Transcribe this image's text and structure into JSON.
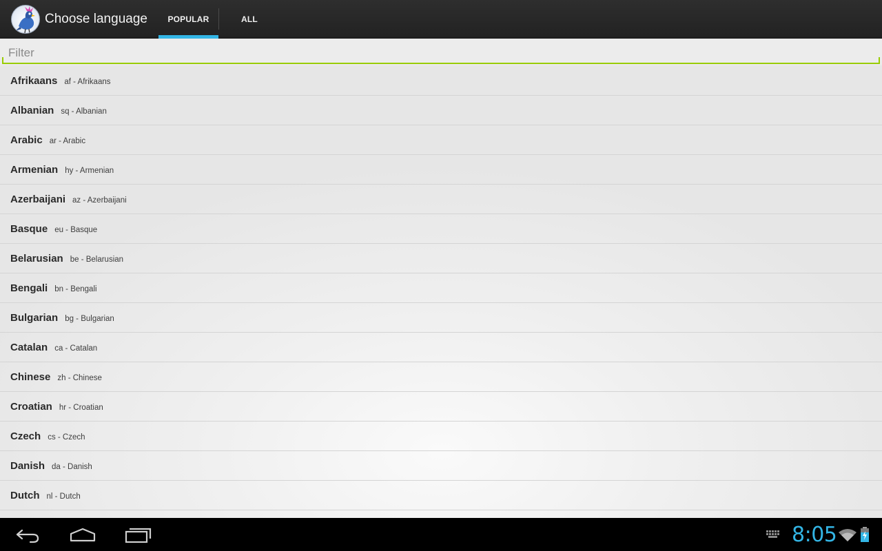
{
  "app": {
    "title": "Choose language",
    "icon": "parrot-app-icon"
  },
  "tabs": [
    {
      "label": "POPULAR",
      "active": true
    },
    {
      "label": "ALL",
      "active": false
    }
  ],
  "filter": {
    "placeholder": "Filter",
    "value": ""
  },
  "languages": [
    {
      "name": "Afrikaans",
      "code": "af - Afrikaans"
    },
    {
      "name": "Albanian",
      "code": "sq - Albanian"
    },
    {
      "name": "Arabic",
      "code": "ar - Arabic"
    },
    {
      "name": "Armenian",
      "code": "hy - Armenian"
    },
    {
      "name": "Azerbaijani",
      "code": "az - Azerbaijani"
    },
    {
      "name": "Basque",
      "code": "eu - Basque"
    },
    {
      "name": "Belarusian",
      "code": "be - Belarusian"
    },
    {
      "name": "Bengali",
      "code": "bn - Bengali"
    },
    {
      "name": "Bulgarian",
      "code": "bg - Bulgarian"
    },
    {
      "name": "Catalan",
      "code": "ca - Catalan"
    },
    {
      "name": "Chinese",
      "code": "zh - Chinese"
    },
    {
      "name": "Croatian",
      "code": "hr - Croatian"
    },
    {
      "name": "Czech",
      "code": "cs - Czech"
    },
    {
      "name": "Danish",
      "code": "da - Danish"
    },
    {
      "name": "Dutch",
      "code": "nl - Dutch"
    }
  ],
  "status_bar": {
    "time": "8:05"
  },
  "colors": {
    "accent": "#33b5e5",
    "filter_underline": "#99cc00",
    "action_bar": "#262626"
  }
}
